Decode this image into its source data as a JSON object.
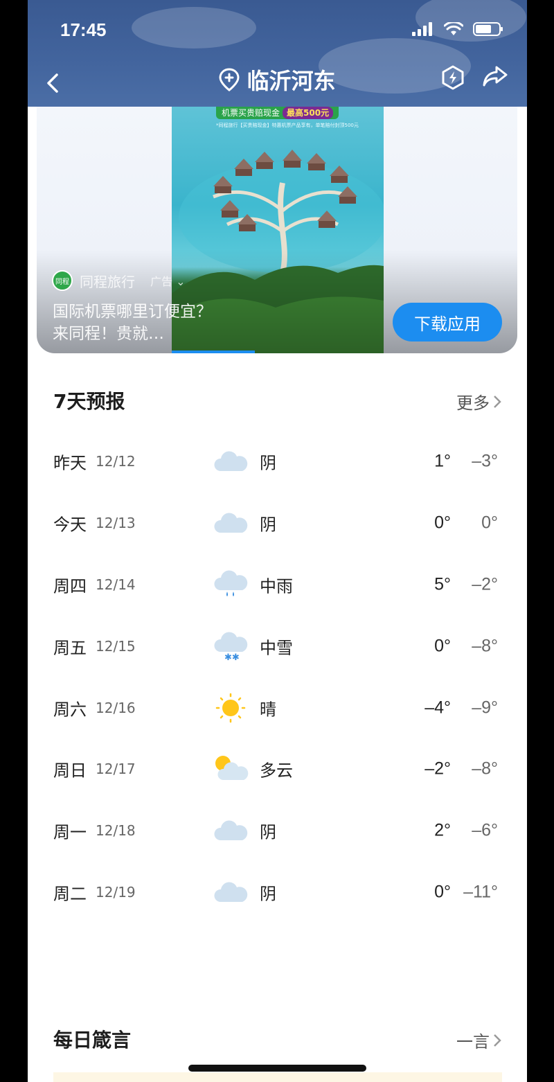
{
  "status": {
    "time": "17:45"
  },
  "nav": {
    "title": "临沂河东"
  },
  "ad": {
    "banner_text": "机票买贵赔现金",
    "banner_highlight": "最高500元",
    "banner_sub": "*同程旅行【买贵赔现金】特惠机票产品享有，单笔赔付封顶500元",
    "brand": "同程旅行",
    "logo_text": "同程",
    "tag": "广告",
    "text": "国际机票哪里订便宜？来同程！贵就…",
    "button": "下载应用"
  },
  "forecast": {
    "title": "7天预报",
    "more": "更多",
    "days": [
      {
        "day": "昨天",
        "date": "12/12",
        "icon": "cloudy-icon",
        "condition": "阴",
        "high": "1°",
        "low": "–3°"
      },
      {
        "day": "今天",
        "date": "12/13",
        "icon": "cloudy-icon",
        "condition": "阴",
        "high": "0°",
        "low": "0°"
      },
      {
        "day": "周四",
        "date": "12/14",
        "icon": "rain-icon",
        "condition": "中雨",
        "high": "5°",
        "low": "–2°"
      },
      {
        "day": "周五",
        "date": "12/15",
        "icon": "snow-icon",
        "condition": "中雪",
        "high": "0°",
        "low": "–8°"
      },
      {
        "day": "周六",
        "date": "12/16",
        "icon": "sunny-icon",
        "condition": "晴",
        "high": "–4°",
        "low": "–9°"
      },
      {
        "day": "周日",
        "date": "12/17",
        "icon": "partly-cloudy-icon",
        "condition": "多云",
        "high": "–2°",
        "low": "–8°"
      },
      {
        "day": "周一",
        "date": "12/18",
        "icon": "cloudy-icon",
        "condition": "阴",
        "high": "2°",
        "low": "–6°"
      },
      {
        "day": "周二",
        "date": "12/19",
        "icon": "cloudy-icon",
        "condition": "阴",
        "high": "0°",
        "low": "–11°"
      }
    ]
  },
  "quote": {
    "title": "每日箴言",
    "more": "一言"
  }
}
